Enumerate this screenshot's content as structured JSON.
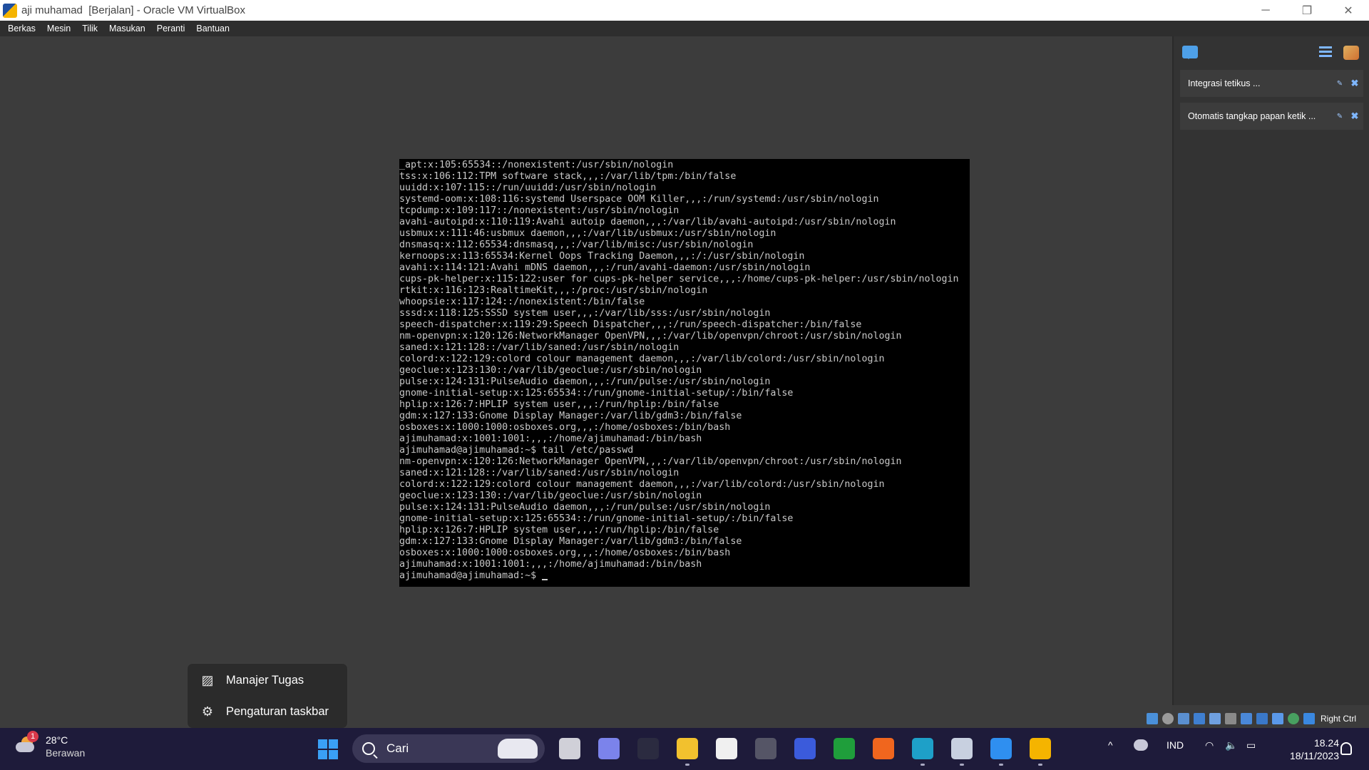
{
  "window": {
    "title": "aji muhamad  [Berjalan] - Oracle VM VirtualBox",
    "minimize": "─",
    "maximize": "❐",
    "close": "✕"
  },
  "menubar": {
    "items": [
      "Berkas",
      "Mesin",
      "Tilik",
      "Masukan",
      "Peranti",
      "Bantuan"
    ]
  },
  "terminal": {
    "lines": [
      "_apt:x:105:65534::/nonexistent:/usr/sbin/nologin",
      "tss:x:106:112:TPM software stack,,,:/var/lib/tpm:/bin/false",
      "uuidd:x:107:115::/run/uuidd:/usr/sbin/nologin",
      "systemd-oom:x:108:116:systemd Userspace OOM Killer,,,:/run/systemd:/usr/sbin/nologin",
      "tcpdump:x:109:117::/nonexistent:/usr/sbin/nologin",
      "avahi-autoipd:x:110:119:Avahi autoip daemon,,,:/var/lib/avahi-autoipd:/usr/sbin/nologin",
      "usbmux:x:111:46:usbmux daemon,,,:/var/lib/usbmux:/usr/sbin/nologin",
      "dnsmasq:x:112:65534:dnsmasq,,,:/var/lib/misc:/usr/sbin/nologin",
      "kernoops:x:113:65534:Kernel Oops Tracking Daemon,,,:/:/usr/sbin/nologin",
      "avahi:x:114:121:Avahi mDNS daemon,,,:/run/avahi-daemon:/usr/sbin/nologin",
      "cups-pk-helper:x:115:122:user for cups-pk-helper service,,,:/home/cups-pk-helper:/usr/sbin/nologin",
      "rtkit:x:116:123:RealtimeKit,,,:/proc:/usr/sbin/nologin",
      "whoopsie:x:117:124::/nonexistent:/bin/false",
      "sssd:x:118:125:SSSD system user,,,:/var/lib/sss:/usr/sbin/nologin",
      "speech-dispatcher:x:119:29:Speech Dispatcher,,,:/run/speech-dispatcher:/bin/false",
      "nm-openvpn:x:120:126:NetworkManager OpenVPN,,,:/var/lib/openvpn/chroot:/usr/sbin/nologin",
      "saned:x:121:128::/var/lib/saned:/usr/sbin/nologin",
      "colord:x:122:129:colord colour management daemon,,,:/var/lib/colord:/usr/sbin/nologin",
      "geoclue:x:123:130::/var/lib/geoclue:/usr/sbin/nologin",
      "pulse:x:124:131:PulseAudio daemon,,,:/run/pulse:/usr/sbin/nologin",
      "gnome-initial-setup:x:125:65534::/run/gnome-initial-setup/:/bin/false",
      "hplip:x:126:7:HPLIP system user,,,:/run/hplip:/bin/false",
      "gdm:x:127:133:Gnome Display Manager:/var/lib/gdm3:/bin/false",
      "osboxes:x:1000:1000:osboxes.org,,,:/home/osboxes:/bin/bash",
      "ajimuhamad:x:1001:1001:,,,:/home/ajimuhamad:/bin/bash",
      "ajimuhamad@ajimuhamad:~$ tail /etc/passwd",
      "nm-openvpn:x:120:126:NetworkManager OpenVPN,,,:/var/lib/openvpn/chroot:/usr/sbin/nologin",
      "saned:x:121:128::/var/lib/saned:/usr/sbin/nologin",
      "colord:x:122:129:colord colour management daemon,,,:/var/lib/colord:/usr/sbin/nologin",
      "geoclue:x:123:130::/var/lib/geoclue:/usr/sbin/nologin",
      "pulse:x:124:131:PulseAudio daemon,,,:/run/pulse:/usr/sbin/nologin",
      "gnome-initial-setup:x:125:65534::/run/gnome-initial-setup/:/bin/false",
      "hplip:x:126:7:HPLIP system user,,,:/run/hplip:/bin/false",
      "gdm:x:127:133:Gnome Display Manager:/var/lib/gdm3:/bin/false",
      "osboxes:x:1000:1000:osboxes.org,,,:/home/osboxes:/bin/bash",
      "ajimuhamad:x:1001:1001:,,,:/home/ajimuhamad:/bin/bash"
    ],
    "prompt": "ajimuhamad@ajimuhamad:~$ "
  },
  "notifications": [
    {
      "text": "Integrasi tetikus ...",
      "pin": "✎",
      "close": "✖"
    },
    {
      "text": "Otomatis tangkap papan ketik ...",
      "pin": "✎",
      "close": "✖"
    }
  ],
  "statusbar": {
    "host_key": "Right Ctrl",
    "icons": [
      "hard-disk-icon",
      "optical-drive-icon",
      "audio-icon",
      "network-icon",
      "usb-icon",
      "shared-folder-icon",
      "display-icon",
      "recording-icon",
      "cpu-icon",
      "mouse-integration-icon",
      "keyboard-capture-icon"
    ]
  },
  "context_menu": {
    "items": [
      {
        "label": "Manajer Tugas",
        "icon": "task-manager-icon"
      },
      {
        "label": "Pengaturan taskbar",
        "icon": "settings-gear-icon"
      }
    ]
  },
  "taskbar": {
    "weather": {
      "temp": "28°C",
      "condition": "Berawan",
      "badge": "1"
    },
    "search_label": "Cari",
    "apps": [
      {
        "name": "task-view-icon",
        "color": "#d0d0d8"
      },
      {
        "name": "teams-chat-icon",
        "color": "#7b83eb"
      },
      {
        "name": "terminal-app-icon",
        "color": "#2b2b40"
      },
      {
        "name": "file-explorer-icon",
        "color": "#f2c12e"
      },
      {
        "name": "microsoft-store-icon",
        "color": "#f0f0f0"
      },
      {
        "name": "unity-hub-icon",
        "color": "#555566"
      },
      {
        "name": "code-editor-icon",
        "color": "#3b5bdb"
      },
      {
        "name": "xbox-icon",
        "color": "#1f9e3b"
      },
      {
        "name": "firefox-icon",
        "color": "#f0661e"
      },
      {
        "name": "edge-icon",
        "color": "#1ea0c8"
      },
      {
        "name": "virtualbox-icon",
        "color": "#c8d0e0"
      },
      {
        "name": "photos-icon",
        "color": "#2f8ff0"
      },
      {
        "name": "virtualbox-vm-icon",
        "color": "#f5b400"
      }
    ],
    "tray": {
      "chevron": "^",
      "language": "IND",
      "wifi": "◠",
      "volume": "🔈",
      "battery": "▭"
    },
    "clock": {
      "time": "18.24",
      "date": "18/11/2023"
    }
  }
}
